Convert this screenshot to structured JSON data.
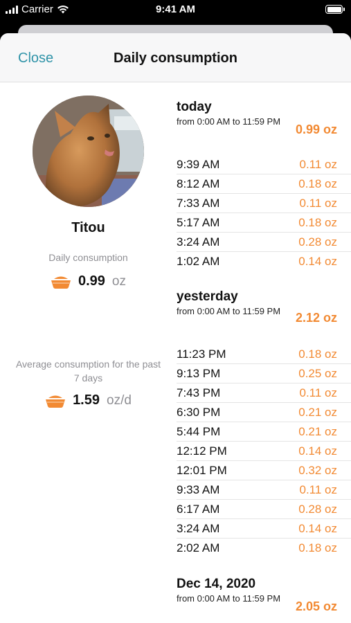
{
  "status_bar": {
    "carrier": "Carrier",
    "time": "9:41 AM"
  },
  "nav": {
    "close_label": "Close",
    "title": "Daily consumption"
  },
  "profile": {
    "name": "Titou",
    "daily_label": "Daily consumption",
    "daily_value": "0.99",
    "daily_unit": "oz",
    "avg_label": "Average consumption for the past 7 days",
    "avg_value": "1.59",
    "avg_unit": "oz/d"
  },
  "colors": {
    "accent": "#f28a33",
    "link": "#2f93a8",
    "muted": "#8e8e93"
  },
  "icons": {
    "bowl": "bowl-icon",
    "wifi": "wifi-icon",
    "battery": "battery-icon"
  },
  "days": [
    {
      "title": "today",
      "range": "from 0:00 AM to 11:59 PM",
      "total": "0.99 oz",
      "entries": [
        {
          "time": "9:39 AM",
          "amount": "0.11 oz"
        },
        {
          "time": "8:12 AM",
          "amount": "0.18 oz"
        },
        {
          "time": "7:33 AM",
          "amount": "0.11 oz"
        },
        {
          "time": "5:17 AM",
          "amount": "0.18 oz"
        },
        {
          "time": "3:24 AM",
          "amount": "0.28 oz"
        },
        {
          "time": "1:02 AM",
          "amount": "0.14 oz"
        }
      ]
    },
    {
      "title": "yesterday",
      "range": "from 0:00 AM to 11:59 PM",
      "total": "2.12 oz",
      "entries": [
        {
          "time": "11:23 PM",
          "amount": "0.18 oz"
        },
        {
          "time": "9:13 PM",
          "amount": "0.25 oz"
        },
        {
          "time": "7:43 PM",
          "amount": "0.11 oz"
        },
        {
          "time": "6:30 PM",
          "amount": "0.21 oz"
        },
        {
          "time": "5:44 PM",
          "amount": "0.21 oz"
        },
        {
          "time": "12:12 PM",
          "amount": "0.14 oz"
        },
        {
          "time": "12:01 PM",
          "amount": "0.32 oz"
        },
        {
          "time": "9:33 AM",
          "amount": "0.11 oz"
        },
        {
          "time": "6:17 AM",
          "amount": "0.28 oz"
        },
        {
          "time": "3:24 AM",
          "amount": "0.14 oz"
        },
        {
          "time": "2:02 AM",
          "amount": "0.18 oz"
        }
      ]
    },
    {
      "title": "Dec 14, 2020",
      "range": "from 0:00 AM to 11:59 PM",
      "total": "2.05 oz",
      "entries": []
    }
  ]
}
